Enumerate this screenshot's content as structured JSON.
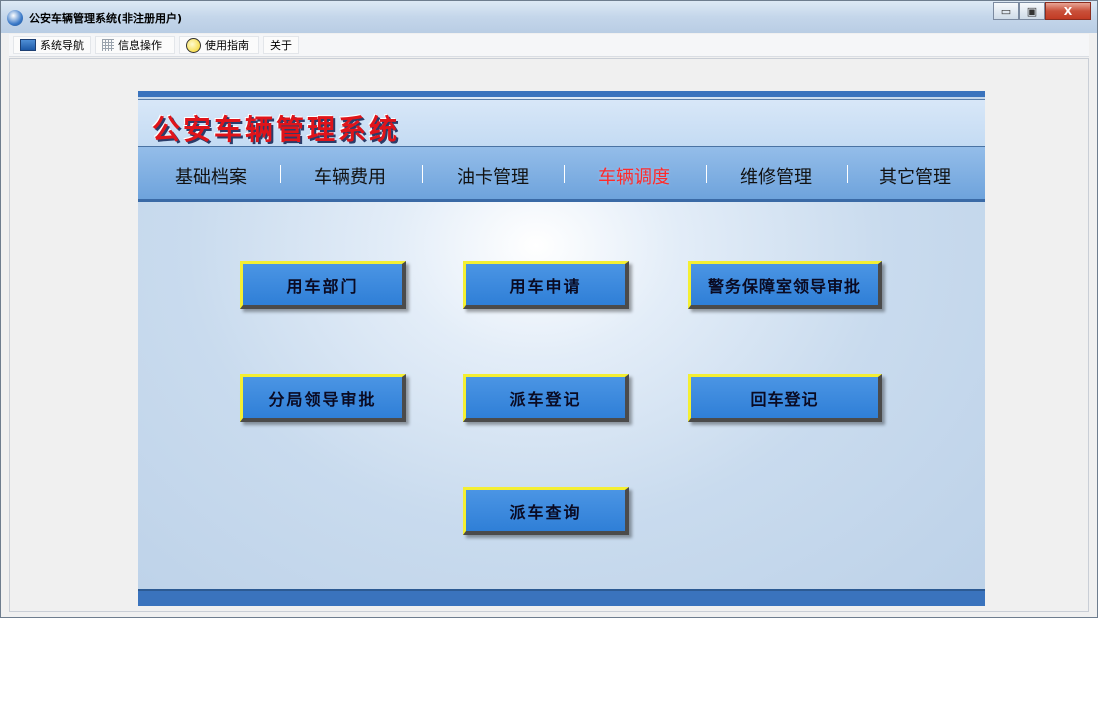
{
  "window": {
    "title": "公安车辆管理系统(非注册用户)",
    "controls": {
      "minimize": "▭",
      "restore": "▣",
      "close": "X"
    }
  },
  "menubar": {
    "items": [
      {
        "label": "系统导航",
        "icon": "monitor-icon"
      },
      {
        "label": "信息操作",
        "icon": "grid-icon"
      },
      {
        "label": "使用指南",
        "icon": "lightbulb-icon"
      },
      {
        "label": "关于",
        "icon": ""
      }
    ]
  },
  "panel": {
    "logo_text": "公安车辆管理系统",
    "nav": [
      {
        "label": "基础档案",
        "active": false
      },
      {
        "label": "车辆费用",
        "active": false
      },
      {
        "label": "油卡管理",
        "active": false
      },
      {
        "label": "车辆调度",
        "active": true
      },
      {
        "label": "维修管理",
        "active": false
      },
      {
        "label": "其它管理",
        "active": false
      }
    ],
    "buttons": [
      {
        "label": "用车部门"
      },
      {
        "label": "用车申请"
      },
      {
        "label": "警务保障室领导审批"
      },
      {
        "label": "分局领导审批"
      },
      {
        "label": "派车登记"
      },
      {
        "label": "回车登记"
      },
      {
        "label": "派车查询"
      }
    ]
  },
  "colors": {
    "accent_blue": "#3a73bd",
    "button_blue": "#3b88dd",
    "button_highlight": "#f4ef33",
    "logo_red": "#e0141a",
    "active_nav": "#ff2a2a"
  }
}
